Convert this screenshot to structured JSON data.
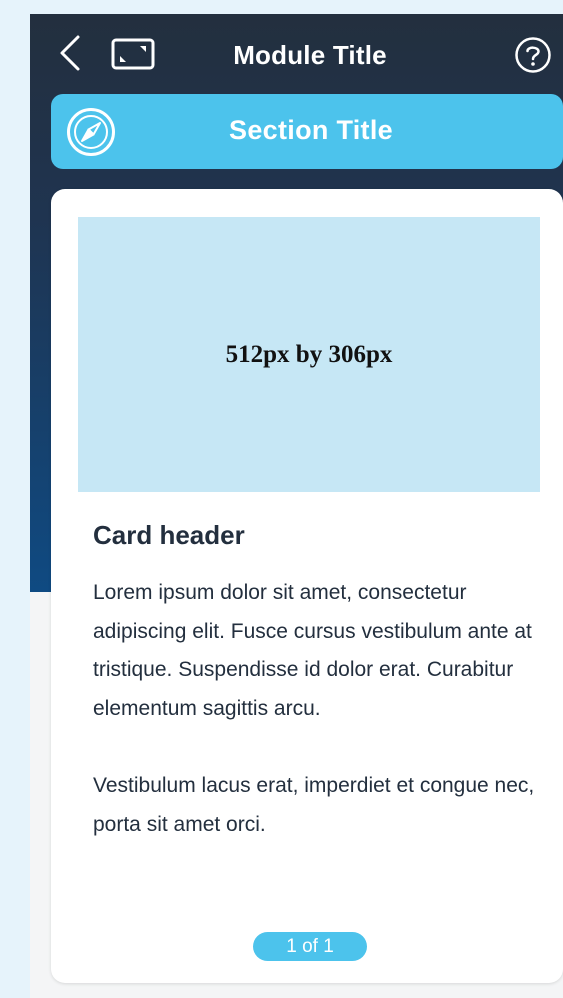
{
  "header": {
    "title": "Module Title",
    "back_icon": "chevron-left-icon",
    "expand_icon": "expand-icon",
    "help_icon": "help-icon"
  },
  "section": {
    "title": "Section Title",
    "icon": "compass-icon"
  },
  "card": {
    "image_label": "512px by 306px",
    "header": "Card header",
    "paragraphs": [
      "Lorem ipsum dolor sit amet, consectetur adipiscing elit. Fusce cursus vestibulum ante at tristique. Suspendisse id dolor erat. Curabitur elementum sagittis arcu.",
      "Vestibulum lacus erat, imperdiet et congue nec, porta sit amet orci."
    ],
    "pager": "1 of 1"
  },
  "colors": {
    "header_dark": "#232f3e",
    "gradient_end": "#0f4a82",
    "accent": "#4cc3ec",
    "image_placeholder": "#c6e7f5",
    "page_background": "#e6f3fb"
  }
}
